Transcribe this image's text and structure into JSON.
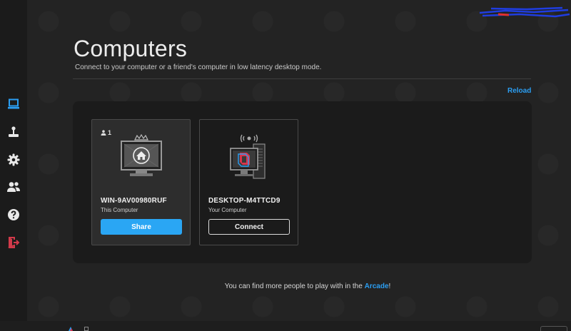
{
  "header": {
    "title": "Computers",
    "subtitle": "Connect to your computer or a friend's computer in low latency desktop mode.",
    "reload_label": "Reload"
  },
  "sidebar": {
    "items": [
      {
        "name": "computers",
        "icon": "computer-icon",
        "color": "#2b9ef2",
        "active": true
      },
      {
        "name": "arcade",
        "icon": "joystick-icon",
        "color": "#e8e8e8"
      },
      {
        "name": "settings",
        "icon": "gear-icon",
        "color": "#e8e8e8"
      },
      {
        "name": "friends",
        "icon": "users-icon",
        "color": "#e8e8e8"
      },
      {
        "name": "help",
        "icon": "question-icon",
        "color": "#e8e8e8"
      },
      {
        "name": "logout",
        "icon": "logout-icon",
        "color": "#d23a4a"
      }
    ]
  },
  "computers": [
    {
      "users_count": "1",
      "name": "WIN-9AV00980RUF",
      "subtitle": "This Computer",
      "button_label": "Share",
      "icon": "home-monitor-icon"
    },
    {
      "name": "DESKTOP-M4TTCD9",
      "subtitle": "Your Computer",
      "button_label": "Connect",
      "icon": "desktop-tower-icon"
    }
  ],
  "footer": {
    "text_before": "You can find more people to play with in the ",
    "link_label": "Arcade",
    "text_after": "!"
  },
  "colors": {
    "accent": "#2b9ef2",
    "background": "#232323",
    "panel": "#1b1b1b",
    "logout": "#d23a4a"
  }
}
